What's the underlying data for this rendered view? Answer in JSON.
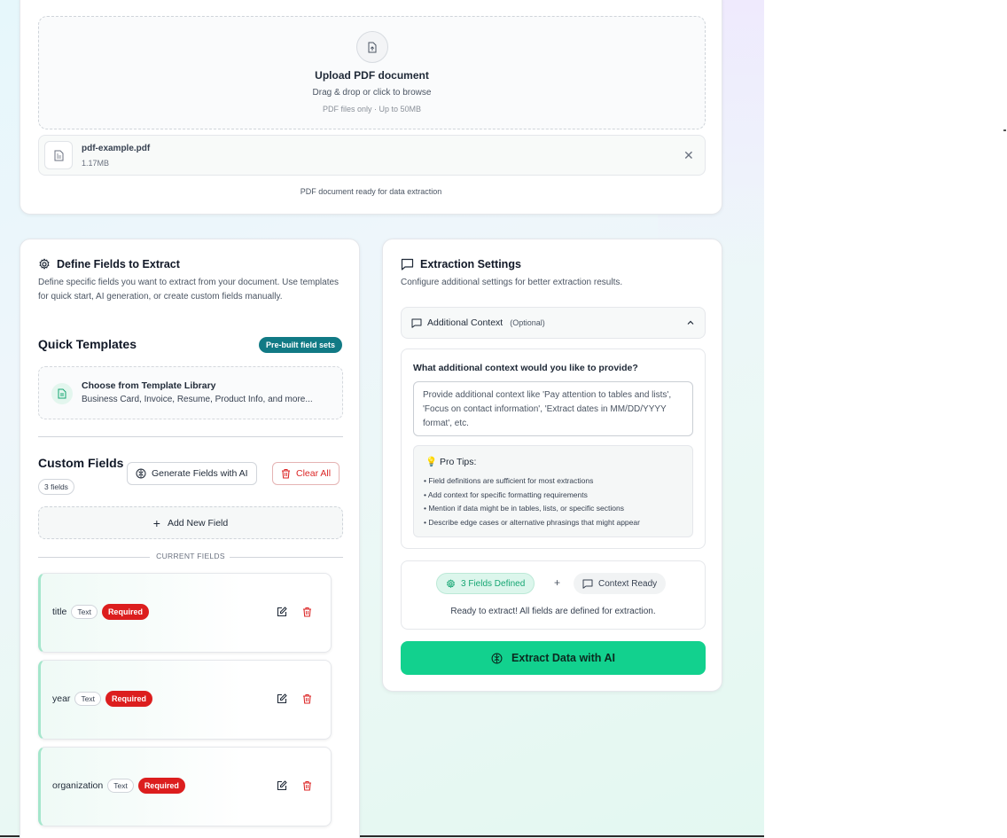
{
  "upload": {
    "title": "Upload PDF document",
    "subtitle": "Drag & drop or click to browse",
    "hint": "PDF files only · Up to 50MB",
    "file_name": "pdf-example.pdf",
    "file_size": "1.17MB",
    "ready_text": "PDF document ready for data extraction"
  },
  "fields_panel": {
    "title": "Define Fields to Extract",
    "description": "Define specific fields you want to extract from your document. Use templates for quick start, AI generation, or create custom fields manually.",
    "quick_templates_title": "Quick Templates",
    "prebuilt_badge": "Pre-built field sets",
    "template_title": "Choose from Template Library",
    "template_subtitle": "Business Card, Invoice, Resume, Product Info, and more...",
    "custom_fields_title": "Custom Fields",
    "fields_count": "3 fields",
    "generate_label": "Generate Fields with AI",
    "clear_label": "Clear All",
    "add_label": "Add New Field",
    "current_fields_label": "CURRENT FIELDS",
    "fields": [
      {
        "name": "title",
        "type": "Text",
        "required": "Required"
      },
      {
        "name": "year",
        "type": "Text",
        "required": "Required"
      },
      {
        "name": "organization",
        "type": "Text",
        "required": "Required"
      }
    ]
  },
  "settings_panel": {
    "title": "Extraction Settings",
    "description": "Configure additional settings for better extraction results.",
    "accordion_title": "Additional Context",
    "accordion_optional": "(Optional)",
    "context_question": "What additional context would you like to provide?",
    "context_placeholder": "Provide additional context like 'Pay attention to tables and lists', 'Focus on contact information', 'Extract dates in MM/DD/YYYY format', etc.",
    "tips_title": "💡 Pro Tips:",
    "tips": [
      "• Field definitions are sufficient for most extractions",
      "• Add context for specific formatting requirements",
      "• Mention if data might be in tables, lists, or specific sections",
      "• Describe edge cases or alternative phrasings that might appear"
    ],
    "fields_defined_chip": "3 Fields Defined",
    "plus": "+",
    "context_ready_chip": "Context Ready",
    "status_text": "Ready to extract! All fields are defined for extraction.",
    "extract_label": "Extract Data with AI"
  },
  "colors": {
    "accent_green": "#12d18e",
    "teal_badge": "#117a85",
    "required_red": "#dc1e1e"
  }
}
